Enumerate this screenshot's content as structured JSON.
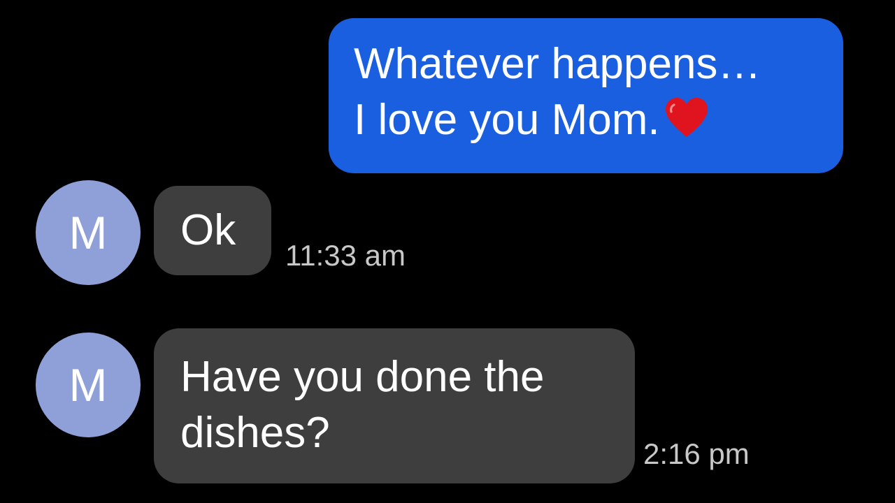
{
  "colors": {
    "background": "#000000",
    "sent_bubble": "#1a5fe0",
    "received_bubble": "#3e3e3e",
    "avatar": "#8fa0d8",
    "timestamp": "#c8c8c8",
    "text": "#ffffff"
  },
  "sent_message": {
    "line1": "Whatever happens…",
    "line2": "I love you Mom.",
    "emoji_icon": "red-heart-icon"
  },
  "received_messages": [
    {
      "avatar_initial": "M",
      "text": "Ok",
      "time": "11:33 am"
    },
    {
      "avatar_initial": "M",
      "line1": "Have you done the",
      "line2": "dishes?",
      "time": "2:16 pm"
    }
  ]
}
